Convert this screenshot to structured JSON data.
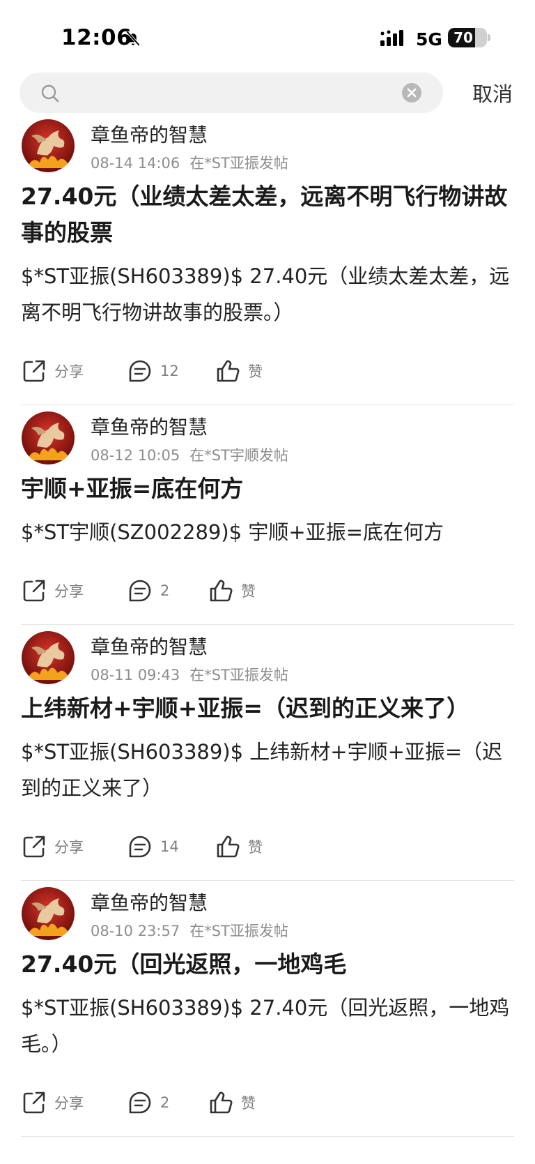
{
  "status_bar": {
    "time": "12:06",
    "network": "5G",
    "battery": "70",
    "battery_level": 0.7,
    "icons": [
      "bell-slash-icon",
      "signal-icon",
      "battery-icon"
    ]
  },
  "search": {
    "placeholder": "",
    "value": "",
    "cancel_label": "取消"
  },
  "posts": [
    {
      "author": "章鱼帝的智慧",
      "time": "08-14 14:06",
      "where": "在*ST亚振发帖",
      "title": "27.40元（业绩太差太差，远离不明飞行物讲故事的股票",
      "body": "$*ST亚振(SH603389)$ 27.40元（业绩太差太差，远离不明飞行物讲故事的股票。）",
      "share_label": "分享",
      "comments": "12",
      "like_label": "赞"
    },
    {
      "author": "章鱼帝的智慧",
      "time": "08-12 10:05",
      "where": "在*ST宇顺发帖",
      "title": "宇顺+亚振=底在何方",
      "body": "$*ST宇顺(SZ002289)$ 宇顺+亚振=底在何方",
      "share_label": "分享",
      "comments": "2",
      "like_label": "赞"
    },
    {
      "author": "章鱼帝的智慧",
      "time": "08-11 09:43",
      "where": "在*ST亚振发帖",
      "title": "上纬新材+宇顺+亚振=（迟到的正义来了）",
      "body": "$*ST亚振(SH603389)$ 上纬新材+宇顺+亚振=（迟到的正义来了）",
      "share_label": "分享",
      "comments": "14",
      "like_label": "赞"
    },
    {
      "author": "章鱼帝的智慧",
      "time": "08-10 23:57",
      "where": "在*ST亚振发帖",
      "title": "27.40元（回光返照，一地鸡毛",
      "body": "$*ST亚振(SH603389)$ 27.40元（回光返照，一地鸡毛。）",
      "share_label": "分享",
      "comments": "2",
      "like_label": "赞"
    }
  ]
}
